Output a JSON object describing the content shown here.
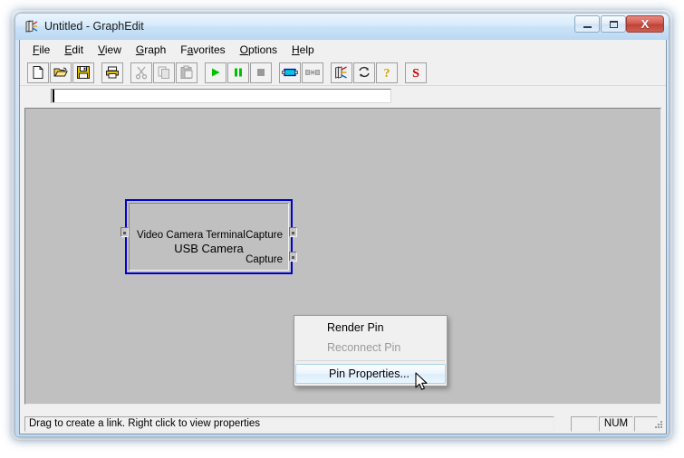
{
  "window": {
    "title": "Untitled - GraphEdit",
    "app_icon": "graphedit-filter-icon",
    "caption_buttons": {
      "minimize": "minimize-icon",
      "maximize": "maximize-icon",
      "close": "X"
    }
  },
  "menu": {
    "items": [
      {
        "label": "File",
        "accel": "F"
      },
      {
        "label": "Edit",
        "accel": "E"
      },
      {
        "label": "View",
        "accel": "V"
      },
      {
        "label": "Graph",
        "accel": "G"
      },
      {
        "label": "Favorites",
        "accel": "a"
      },
      {
        "label": "Options",
        "accel": "O"
      },
      {
        "label": "Help",
        "accel": "H"
      }
    ]
  },
  "toolbar": {
    "buttons": [
      {
        "name": "new-button",
        "icon": "new-document-icon",
        "enabled": true
      },
      {
        "name": "open-button",
        "icon": "open-folder-icon",
        "enabled": true
      },
      {
        "name": "save-button",
        "icon": "floppy-disk-icon",
        "enabled": true
      },
      {
        "name": "print-button",
        "icon": "printer-icon",
        "enabled": true
      },
      {
        "name": "cut-button",
        "icon": "scissors-icon",
        "enabled": false
      },
      {
        "name": "copy-button",
        "icon": "copy-pages-icon",
        "enabled": false
      },
      {
        "name": "paste-button",
        "icon": "clipboard-icon",
        "enabled": false
      },
      {
        "name": "play-button",
        "icon": "play-triangle-icon",
        "enabled": true
      },
      {
        "name": "pause-button",
        "icon": "pause-bars-icon",
        "enabled": true
      },
      {
        "name": "stop-button",
        "icon": "stop-square-icon",
        "enabled": true
      },
      {
        "name": "insert-filter-button",
        "icon": "filter-block-icon",
        "enabled": true
      },
      {
        "name": "connect-button",
        "icon": "connect-pins-icon",
        "enabled": false
      },
      {
        "name": "graph-properties-button",
        "icon": "graphedit-filter-icon",
        "enabled": true
      },
      {
        "name": "refresh-button",
        "icon": "refresh-arrows-icon",
        "enabled": true
      },
      {
        "name": "help-button",
        "icon": "question-mark-icon",
        "enabled": true
      },
      {
        "name": "script-button",
        "icon": "letter-s-icon",
        "enabled": true,
        "label": "S"
      }
    ]
  },
  "strip": {
    "value": "",
    "placeholder": ""
  },
  "graph": {
    "filter": {
      "vendor_label": "Video Camera Terminal",
      "name": "USB Camera",
      "selected": true,
      "selection_color": "#0000d0",
      "input_pins": [
        {
          "name": "pin-in-0",
          "label": ""
        }
      ],
      "output_pins": [
        {
          "name": "pin-out-0",
          "label": "Capture"
        },
        {
          "name": "pin-out-1",
          "label": "Capture"
        }
      ]
    }
  },
  "context_menu": {
    "items": [
      {
        "label": "Render Pin",
        "enabled": true,
        "highlighted": false
      },
      {
        "label": "Reconnect Pin",
        "enabled": false,
        "highlighted": false
      },
      {
        "label": "Pin Properties...",
        "enabled": true,
        "highlighted": true
      }
    ]
  },
  "status_bar": {
    "message": "Drag to create a link. Right click to view properties",
    "pane_1": "",
    "pane_2": "NUM",
    "pane_3": ""
  }
}
